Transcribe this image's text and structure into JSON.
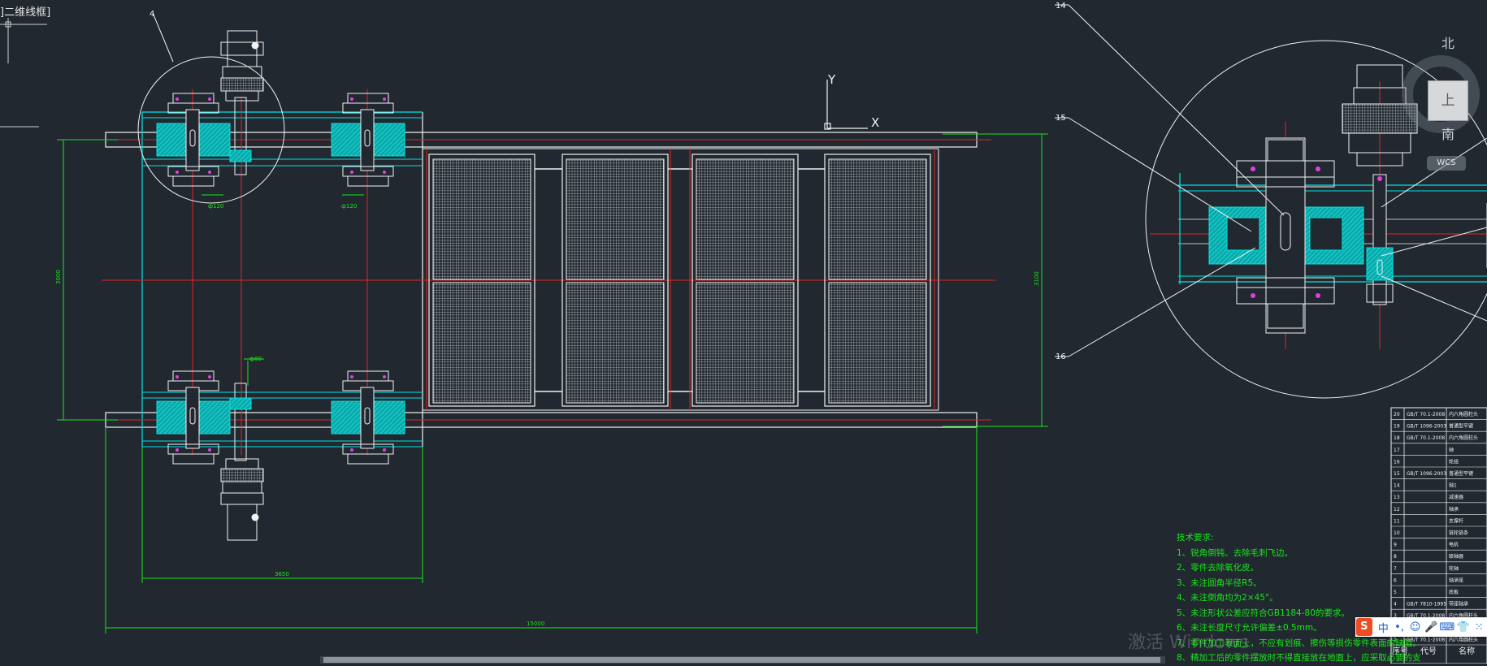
{
  "viewport": {
    "label": "]二维线框]"
  },
  "ucs": {
    "x_label": "X",
    "y_label": "Y"
  },
  "callouts": [
    "4",
    "14",
    "15",
    "16"
  ],
  "dimensions": {
    "overall_width": "15000",
    "left_width": "3650",
    "height_outer": "3000",
    "height_right": "3100",
    "dim_a": "ф120",
    "dim_b": "ф120",
    "dim_c": "ф80"
  },
  "tech_notes": {
    "title": "技术要求:",
    "items": [
      "1、锐角倒钝、去除毛刺飞边。",
      "2、零件去除氧化皮。",
      "3、未注圆角半径R5。",
      "4、未注倒角均为2×45°。",
      "5、未注形状公差应符合GB1184-80的要求。",
      "6、未注长度尺寸允许偏差±0.5mm。",
      "7、零件加工表面上，不应有划痕、擦伤等损伤零件表面的缺陷。",
      "8、精加工后的零件摆放时不得直接放在地面上，应采取必要的支"
    ]
  },
  "bom": {
    "rows": [
      {
        "no": "20",
        "code": "GB/T 70.1-2008",
        "name": "内六角圆柱头"
      },
      {
        "no": "19",
        "code": "GB/T 1096-2003",
        "name": "普通型平键"
      },
      {
        "no": "18",
        "code": "GB/T 70.1-2008",
        "name": "内六角圆柱头"
      },
      {
        "no": "17",
        "code": "",
        "name": "轴"
      },
      {
        "no": "16",
        "code": "",
        "name": "轮组"
      },
      {
        "no": "15",
        "code": "GB/T 1096-2003",
        "name": "普通型平键"
      },
      {
        "no": "14",
        "code": "",
        "name": "轴1"
      },
      {
        "no": "13",
        "code": "",
        "name": "减速器"
      },
      {
        "no": "12",
        "code": "",
        "name": "轴承"
      },
      {
        "no": "11",
        "code": "",
        "name": "支撑杆"
      },
      {
        "no": "10",
        "code": "",
        "name": "链轮链条"
      },
      {
        "no": "9",
        "code": "",
        "name": "电机"
      },
      {
        "no": "8",
        "code": "",
        "name": "联轴器"
      },
      {
        "no": "7",
        "code": "",
        "name": "轮轴"
      },
      {
        "no": "6",
        "code": "",
        "name": "轴承座"
      },
      {
        "no": "5",
        "code": "",
        "name": "底板"
      },
      {
        "no": "4",
        "code": "GB/T 7810-1995",
        "name": "带座轴承"
      },
      {
        "no": "3",
        "code": "GB/T 70.1-2008",
        "name": "内六角圆柱头"
      },
      {
        "no": "2",
        "code": "",
        "name": "网架"
      },
      {
        "no": "1",
        "code": "GB/T 70.1-2008",
        "name": "内六角圆柱头"
      }
    ],
    "header": {
      "no": "序号",
      "code": "代号",
      "name": "名称"
    }
  },
  "viewcube": {
    "north": "北",
    "south": "南",
    "top": "上",
    "wcs": "WCS"
  },
  "watermark": "激活 Windows",
  "ime": {
    "logo": "S",
    "lang": "中",
    "punct": "•,",
    "emoji": "☺",
    "mic": "🎤",
    "keyboard": "⌨",
    "skin": "👕",
    "grid": "⁙"
  },
  "colors": {
    "background": "#212830",
    "cyan": "#00e5e5",
    "red": "#e52222",
    "green": "#19e619",
    "white": "#f2f2f2",
    "magenta": "#e040e0"
  }
}
